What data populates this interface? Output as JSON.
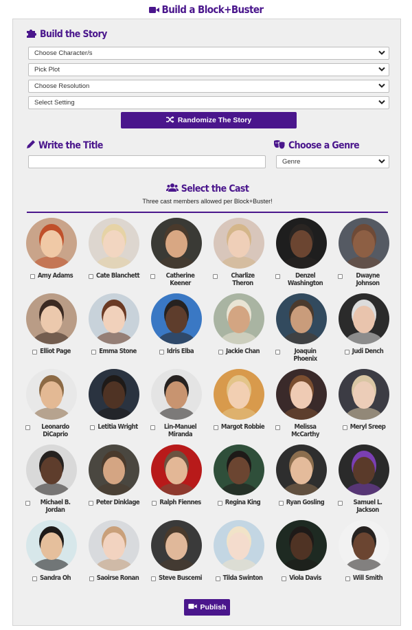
{
  "page_title": "Build a Block+Buster",
  "story": {
    "heading": "Build the Story",
    "selects": [
      "Choose Character/s",
      "Pick Plot",
      "Choose Resolution",
      "Select Setting"
    ],
    "randomize_label": "Randomize The Story"
  },
  "title_section": {
    "heading": "Write the Title",
    "value": ""
  },
  "genre_section": {
    "heading": "Choose a Genre",
    "selected": "Genre"
  },
  "cast": {
    "heading": "Select the Cast",
    "subtitle": "Three cast members allowed per Block+Buster!",
    "members": [
      {
        "name": "Amy Adams",
        "bg": "#c9a48a",
        "skin": "#f0c9a6",
        "hair": "#c0502a"
      },
      {
        "name": "Cate Blanchett",
        "bg": "#ddd6cf",
        "skin": "#f2d6c1",
        "hair": "#e6d3a6"
      },
      {
        "name": "Catherine Keener",
        "bg": "#3a3a35",
        "skin": "#d8a783",
        "hair": "#4a3a2c"
      },
      {
        "name": "Charlize Theron",
        "bg": "#d8c6bb",
        "skin": "#efcfb8",
        "hair": "#d4b68a"
      },
      {
        "name": "Denzel Washington",
        "bg": "#1e1e1e",
        "skin": "#6b4531",
        "hair": "#2a2522"
      },
      {
        "name": "Dwayne Johnson",
        "bg": "#555a63",
        "skin": "#8d5f44",
        "hair": "#6e4a37"
      },
      {
        "name": "Elliot Page",
        "bg": "#b99c86",
        "skin": "#ecc9ad",
        "hair": "#3b2a22"
      },
      {
        "name": "Emma Stone",
        "bg": "#c8d2da",
        "skin": "#f1d1bb",
        "hair": "#6b3a24"
      },
      {
        "name": "Idris Elba",
        "bg": "#3a78c4",
        "skin": "#5e3d2c",
        "hair": "#262220"
      },
      {
        "name": "Jackie Chan",
        "bg": "#a9b4a2",
        "skin": "#d3a582",
        "hair": "#e9e4d4"
      },
      {
        "name": "Joaquin Phoenix",
        "bg": "#324a5e",
        "skin": "#c99c7b",
        "hair": "#4b3a2d"
      },
      {
        "name": "Judi Dench",
        "bg": "#2b2b2b",
        "skin": "#e9c4ad",
        "hair": "#dcdcdc"
      },
      {
        "name": "Leonardo DiCaprio",
        "bg": "#e8e8e8",
        "skin": "#e3b994",
        "hair": "#8c6a45"
      },
      {
        "name": "Letitia Wright",
        "bg": "#2a3340",
        "skin": "#4f3324",
        "hair": "#1e1a18"
      },
      {
        "name": "Lin-Manuel Miranda",
        "bg": "#e4e4e4",
        "skin": "#c89470",
        "hair": "#262220"
      },
      {
        "name": "Margot Robbie",
        "bg": "#d89a4c",
        "skin": "#f2cfb2",
        "hair": "#e3c489"
      },
      {
        "name": "Melissa McCarthy",
        "bg": "#3a2a2a",
        "skin": "#efcbb4",
        "hair": "#7a4e30"
      },
      {
        "name": "Meryl Sreep",
        "bg": "#3c3c44",
        "skin": "#eccdb8",
        "hair": "#d9c6a4"
      },
      {
        "name": "Michael B. Jordan",
        "bg": "#d9d9d9",
        "skin": "#5e3d2c",
        "hair": "#262220"
      },
      {
        "name": "Peter Dinklage",
        "bg": "#4a4740",
        "skin": "#d4a583",
        "hair": "#4a3a2c"
      },
      {
        "name": "Ralph Fiennes",
        "bg": "#b81a1a",
        "skin": "#e3b796",
        "hair": "#6b5340"
      },
      {
        "name": "Regina King",
        "bg": "#2f4f3a",
        "skin": "#6b4531",
        "hair": "#1e1a18"
      },
      {
        "name": "Ryan Gosling",
        "bg": "#2e2e2e",
        "skin": "#e4bb9b",
        "hair": "#8c6e4e"
      },
      {
        "name": "Samuel L. Jackson",
        "bg": "#2a2a2a",
        "skin": "#5a3a2a",
        "hair": "#7b3fb3"
      },
      {
        "name": "Sandra Oh",
        "bg": "#d7e7ea",
        "skin": "#e5bf9c",
        "hair": "#1e1a18"
      },
      {
        "name": "Saoirse Ronan",
        "bg": "#d8dadd",
        "skin": "#f2d3c0",
        "hair": "#c9a07a"
      },
      {
        "name": "Steve Buscemi",
        "bg": "#3a3a3a",
        "skin": "#e0b89a",
        "hair": "#4a3a2c"
      },
      {
        "name": "Tilda Swinton",
        "bg": "#c3d6e3",
        "skin": "#f4dccd",
        "hair": "#f1e3c8"
      },
      {
        "name": "Viola Davis",
        "bg": "#1e2a22",
        "skin": "#4f3324",
        "hair": "#1e1a18"
      },
      {
        "name": "Will Smith",
        "bg": "#f2f2f2",
        "skin": "#6b4531",
        "hair": "#262220"
      }
    ]
  },
  "publish_label": "Publish",
  "colors": {
    "accent": "#4a168c",
    "panel_bg": "#efefef"
  }
}
